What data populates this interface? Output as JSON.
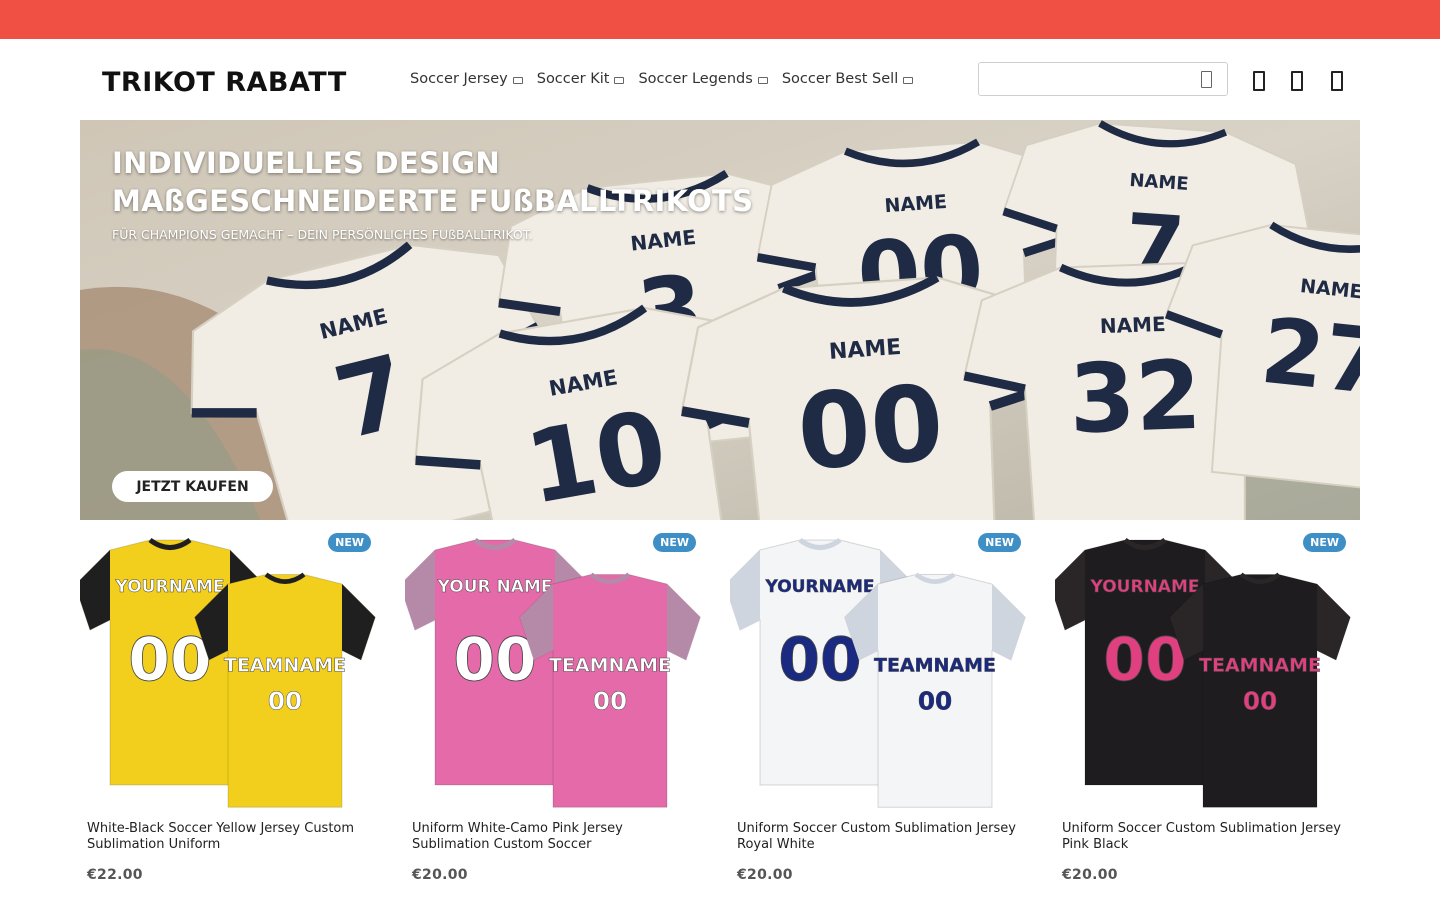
{
  "header": {
    "logo": "TRIKOT RABATT",
    "nav": [
      {
        "label": "Soccer Jersey"
      },
      {
        "label": "Soccer Kit"
      },
      {
        "label": "Soccer Legends"
      },
      {
        "label": "Soccer Best Sell"
      }
    ],
    "search": {
      "placeholder": "",
      "value": ""
    },
    "icons": [
      "search-icon",
      "account-icon",
      "wishlist-icon",
      "cart-icon"
    ]
  },
  "hero": {
    "title_line1": "INDIVIDUELLES DESIGN",
    "title_line2": "MAßGESCHNEIDERTE FUßBALLTRIKOTS",
    "subtitle": "FÜR CHAMPIONS GEMACHT – DEIN PERSÖNLICHES FUßBALLTRIKOT.",
    "cta": "JETZT KAUFEN",
    "jerseys": [
      {
        "name": "NAME",
        "number": "7"
      },
      {
        "name": "NAME",
        "number": "3"
      },
      {
        "name": "NAME",
        "number": "00"
      },
      {
        "name": "NAME",
        "number": "7"
      },
      {
        "name": "NAME",
        "number": "10"
      },
      {
        "name": "NAME",
        "number": "00"
      },
      {
        "name": "NAME",
        "number": "32"
      },
      {
        "name": "NAME",
        "number": "27"
      }
    ]
  },
  "products": [
    {
      "badge": "NEW",
      "name": "White-Black Soccer Yellow Jersey Custom Sublimation Uniform",
      "price": "€22.00",
      "front_text": "YOURNAME",
      "back_text": "TEAMNAME",
      "number": "00",
      "color_main": "#f2cf1c",
      "color_sleeve": "#1f1f1f",
      "color_text": "#ffffff"
    },
    {
      "badge": "NEW",
      "name": "Uniform White-Camo Pink Jersey Sublimation Custom Soccer",
      "price": "€20.00",
      "front_text": "YOUR NAME",
      "back_text": "TEAMNAME",
      "number": "00",
      "color_main": "#e56aa9",
      "color_sleeve": "#b58aa8",
      "color_text": "#ffffff"
    },
    {
      "badge": "NEW",
      "name": "Uniform Soccer Custom Sublimation Jersey Royal White",
      "price": "€20.00",
      "front_text": "YOURNAME",
      "back_text": "TEAMNAME",
      "number": "00",
      "color_main": "#f4f5f7",
      "color_sleeve": "#cfd5df",
      "color_text": "#1a2a80"
    },
    {
      "badge": "NEW",
      "name": "Uniform Soccer Custom Sublimation Jersey Pink Black",
      "price": "€20.00",
      "front_text": "YOURNAME",
      "back_text": "TEAMNAME",
      "number": "00",
      "color_main": "#1e1c1e",
      "color_sleeve": "#2a2628",
      "color_text": "#e0407f"
    }
  ],
  "colors": {
    "topbar": "#f05043",
    "badge": "#3f8fc7",
    "jersey_trim": "#1f2a44"
  }
}
